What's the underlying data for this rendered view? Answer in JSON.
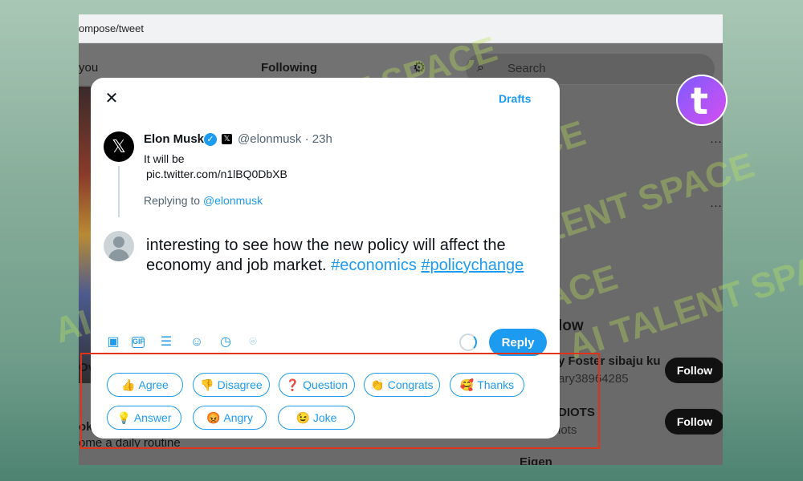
{
  "browser": {
    "url": "ompose/tweet"
  },
  "twitter": {
    "tab_left": "you",
    "tab_following": "Following",
    "search_placeholder": "Search",
    "left_snippet_1": "Ov",
    "left_snippet_2": "ok.",
    "left_snippet_3": "ome a daily routine",
    "left_snippet_k": "k",
    "right_snippet_n": "n",
    "who_to_follow": "low",
    "suggestions": [
      {
        "name": "y Foster sibaju ku",
        "handle": "ary38964285",
        "button": "Follow"
      },
      {
        "name": "DIOTS",
        "handle": "iots",
        "button": "Follow"
      },
      {
        "name": "Eigen",
        "handle": "",
        "button": ""
      }
    ],
    "more_dots": "···"
  },
  "modal": {
    "close_label": "✕",
    "drafts_label": "Drafts",
    "tweet": {
      "author_name": "Elon Musk",
      "handle_time": "@elonmusk · 23h",
      "text_line1": "It will be",
      "text_line2": "pic.twitter.com/n1lBQ0DbXB"
    },
    "replying_prefix": "Replying to ",
    "replying_handle": "@elonmusk",
    "compose_text": "interesting to see how the new policy will affect the economy and job market. ",
    "hashtag1": "#economics",
    "hashtag2": "#policychange",
    "reply_button": "Reply",
    "quick_replies": [
      {
        "emoji": "👍",
        "label": "Agree"
      },
      {
        "emoji": "👎",
        "label": "Disagree"
      },
      {
        "emoji": "❓",
        "label": "Question"
      },
      {
        "emoji": "👏",
        "label": "Congrats"
      },
      {
        "emoji": "🥰",
        "label": "Thanks"
      },
      {
        "emoji": "💡",
        "label": "Answer"
      },
      {
        "emoji": "😡",
        "label": "Angry"
      },
      {
        "emoji": "😉",
        "label": "Joke"
      }
    ]
  },
  "watermark": {
    "text": "AI TALENT SPACE"
  },
  "colors": {
    "accent": "#1d9bf0",
    "highlight_box": "#e0331a"
  }
}
